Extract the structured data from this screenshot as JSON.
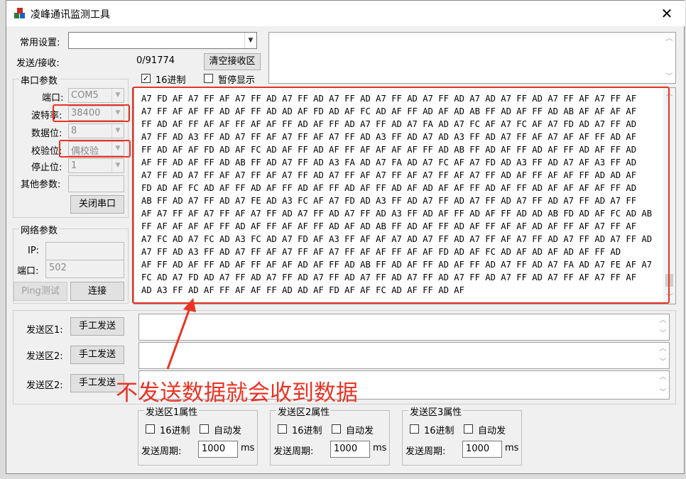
{
  "window": {
    "title": "凌峰通讯监测工具"
  },
  "settings": {
    "common_label": "常用设置:",
    "send_recv_label": "发送/接收:",
    "send_recv_value": "0/91774",
    "clear_button": "清空接收区",
    "hex_label": "16进制",
    "hex_checked": true,
    "pause_label": "暂停显示",
    "pause_checked": false
  },
  "serial": {
    "group_title": "串口参数",
    "port_label": "端口:",
    "port_value": "COM5",
    "baud_label": "波特率:",
    "baud_value": "38400",
    "databits_label": "数据位:",
    "databits_value": "8",
    "parity_label": "校验位:",
    "parity_value": "偶校验",
    "stopbits_label": "停止位:",
    "stopbits_value": "1",
    "other_label": "其他参数:",
    "close_button": "关闭串口"
  },
  "network": {
    "group_title": "网络参数",
    "ip_label": "IP:",
    "port_label": "端口:",
    "port_value": "502",
    "ping_button": "Ping测试",
    "connect_button": "连接"
  },
  "receive": {
    "lines": [
      "A7 FD AF A7 FF AF A7 FF AD A7 FF AD A7 FF AD A7 FF AD A7 FF AD A7 AD A7 FF AD A7 FF AF A7 FF AF",
      "A7 FF AF AF FF AD AF FF AD AD AF FD AD AF FC AD AF FF AD AF AD AB FF AD AF FF AD AB AF AF AF AF",
      "FF AD AF FF AF AF FF AF AF FF AD AF FF AD A7 FF AD A7 FA AD A7 FC AF A7 FC AF A7 FD AD A7 FF AD",
      "A7 FF AD A3 FF AD A7 FF AF A7 FF AF A7 FF AD A3 FF AD A7 AD A3 FF AD A7 FF AF A7 AF AF FF AD AF",
      "FF AD AF AF FD AD AF FC AD AF FF AD AF FF AF AF AF AF FF AD AB FF AD AF FF AD AF FF AD AF FF AD",
      "AF FF AD AF FF AD AB FF AD A7 FF AD A3 FA AD A7 FA AD A7 FC AF A7 FD AD A3 FF AD A7 AF A3 FF AD",
      "A7 FF AD A7 FF AF A7 FF AF A7 FF AD A7 FF AF A7 FF AF A7 FF AF A7 FF AD AF FF AF AF FF AD AD AF",
      "FD AD AF FC AD AF FF AD AF FF AD AF FF AD AF FF AD AF AD AF AF FF AD AF FF AD AF AF AF AF FF AD",
      "AB FF AD A7 FF AD A7 FE AD A3 FC AF A7 FD AD A3 FF AD A7 FF AD A7 FF AD A7 FF AD A7 FF AD A7 FF",
      "AF A7 FF AF A7 FF AF A7 FF AD A7 FF AD A7 FF AD A3 FF AD AF FF AD AF FF AD AD AB FD AD AF FC AD AB",
      "FF AF AF AF AF FF AD AF FF AF AF FF AD AF AD AB FF AD AF FF AD AF FF AF AF AD AF FF AF A7 FF AF",
      "A7 FC AD A7 FC AD A3 FC AD A7 FD AF A3 FF AF AF A7 AD A7 FF AD A7 FF AF A7 FF AD A7 FF AD A7 FF AD",
      "A7 FF AD A3 FF AD A7 FF AF A7 FF AF A7 FF AF AF FF AF AF FD AD AF FC AD AF AD AF AD AF FF AD",
      "AF FF AD AF FF AD AF FF AF AF AD AF FF AD AB FF AD AF FF AD AF FF AD A7 FF AD A7 FA AD A7 FE AF A7",
      "FC AD A7 FD AD A7 FF AD A7 FF AD A7 FF AD A7 FF AD A7 FF AD A7 FF AD A7 FF AD A7 FF AF A7 FF AF",
      "AD A3 FF AD AF FF AF AF FF AD AD AF FD AF AF FC AD AF FF AD AF"
    ]
  },
  "send": {
    "rows": [
      {
        "label": "发送区1:",
        "button": "手工发送"
      },
      {
        "label": "发送区2:",
        "button": "手工发送"
      },
      {
        "label": "发送区2:",
        "button": "手工发送"
      }
    ],
    "props": [
      {
        "title": "发送区1属性",
        "hex_label": "16进制",
        "auto_label": "自动发",
        "period_label": "发送周期:",
        "period_value": "1000",
        "unit": "ms"
      },
      {
        "title": "发送区2属性",
        "hex_label": "16进制",
        "auto_label": "自动发",
        "period_label": "发送周期:",
        "period_value": "1000",
        "unit": "ms"
      },
      {
        "title": "发送区3属性",
        "hex_label": "16进制",
        "auto_label": "自动发",
        "period_label": "发送周期:",
        "period_value": "1000",
        "unit": "ms"
      }
    ]
  },
  "annotation": {
    "text": "不发送数据就会收到数据",
    "color": "#ea3323"
  }
}
